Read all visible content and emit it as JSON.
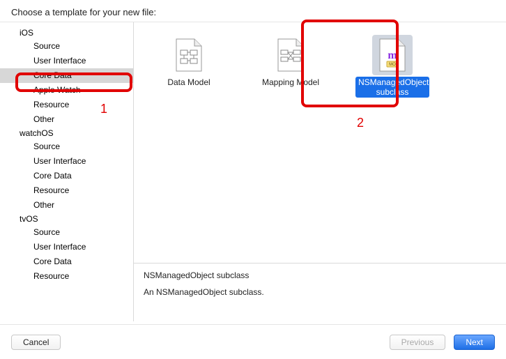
{
  "header": {
    "title": "Choose a template for your new file:"
  },
  "sidebar": {
    "groups": [
      {
        "platform": "iOS",
        "items": [
          {
            "label": "Source"
          },
          {
            "label": "User Interface"
          },
          {
            "label": "Core Data",
            "selected": true
          },
          {
            "label": "Apple Watch"
          },
          {
            "label": "Resource"
          },
          {
            "label": "Other"
          }
        ]
      },
      {
        "platform": "watchOS",
        "items": [
          {
            "label": "Source"
          },
          {
            "label": "User Interface"
          },
          {
            "label": "Core Data"
          },
          {
            "label": "Resource"
          },
          {
            "label": "Other"
          }
        ]
      },
      {
        "platform": "tvOS",
        "items": [
          {
            "label": "Source"
          },
          {
            "label": "User Interface"
          },
          {
            "label": "Core Data"
          },
          {
            "label": "Resource"
          }
        ]
      }
    ]
  },
  "templates": [
    {
      "name": "Data Model",
      "selected": false,
      "icon": "data-model"
    },
    {
      "name": "Mapping Model",
      "selected": false,
      "icon": "mapping-model"
    },
    {
      "name": "NSManagedObject subclass",
      "selected": true,
      "icon": "managed-object"
    }
  ],
  "detail": {
    "title": "NSManagedObject subclass",
    "desc": "An NSManagedObject subclass."
  },
  "footer": {
    "cancel": "Cancel",
    "previous": "Previous",
    "next": "Next"
  },
  "annotations": {
    "num1": "1",
    "num2": "2"
  }
}
